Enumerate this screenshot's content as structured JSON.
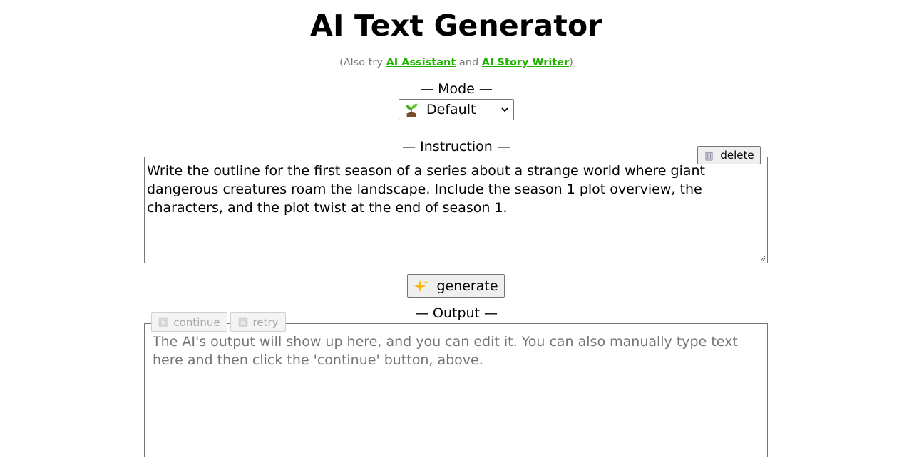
{
  "header": {
    "title": "AI Text Generator",
    "subtitle_prefix": "(Also try ",
    "link_assistant": "AI Assistant",
    "subtitle_and": " and ",
    "link_story": "AI Story Writer",
    "subtitle_suffix": ")"
  },
  "mode": {
    "label": "— Mode —",
    "selected": "Default",
    "icon": "sprout-icon"
  },
  "instruction": {
    "label": "— Instruction —",
    "value": "Write the outline for the first season of a series about a strange world where giant dangerous creatures roam the landscape. Include the season 1 plot overview, the characters, and the plot twist at the end of season 1.",
    "delete_label": "delete"
  },
  "generate": {
    "label": "generate",
    "icon": "sparkles-icon"
  },
  "output": {
    "label": "— Output —",
    "placeholder": "The AI's output will show up here, and you can edit it. You can also manually type text here and then click the 'continue' button, above.",
    "continue_label": "continue",
    "retry_label": "retry"
  },
  "colors": {
    "link": "#1fb300",
    "subtitle": "#7a7a7a",
    "disabled_text": "#a8a8a8"
  }
}
